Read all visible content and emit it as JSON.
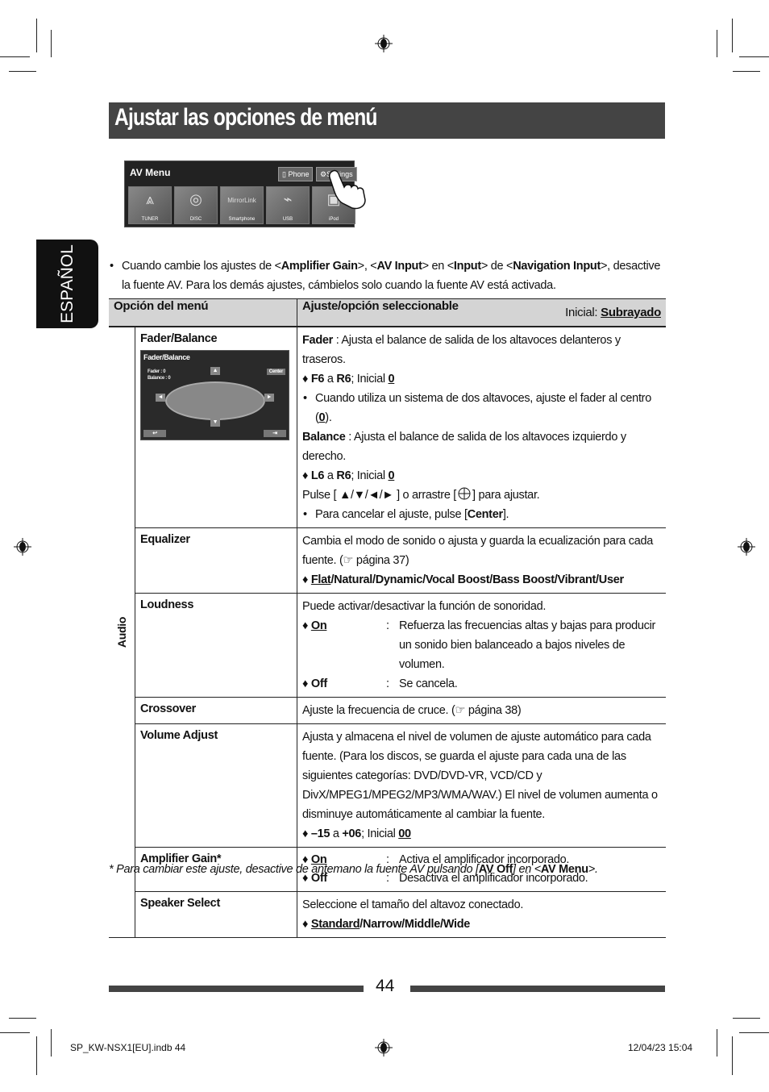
{
  "page": {
    "title": "Ajustar las opciones de menú",
    "language_tab": "ESPAÑOL",
    "page_number": "44",
    "slug_left": "SP_KW-NSX1[EU].indb   44",
    "slug_right": "12/04/23   15:04"
  },
  "av_menu_screen": {
    "title": "AV Menu",
    "buttons": [
      "Phone",
      "Settings"
    ],
    "tiles": [
      "TUNER",
      "DISC",
      "Smartphone",
      "USB",
      "iPod"
    ],
    "tile_overlay": "MirrorLink"
  },
  "note": {
    "text_a": "Cuando cambie los ajustes de <",
    "bold_a": "Amplifier Gain",
    "text_b": ">, <",
    "bold_b": "AV Input",
    "text_c": "> en <",
    "bold_c": "Input",
    "text_d": "> de <",
    "bold_d": "Navigation Input",
    "text_e": ">, desactive la fuente AV. Para los demás ajustes, cámbielos solo cuando la fuente AV está activada."
  },
  "table": {
    "header": {
      "col1": "Opción del menú",
      "col2": "Ajuste/opción seleccionable",
      "initial_label": "Inicial: ",
      "initial_value": "Subrayado"
    },
    "group_label": "Audio",
    "rows": [
      {
        "option": "Fader/Balance",
        "screen": {
          "title": "Fader/Balance",
          "fader": "Fader      : 0",
          "balance": "Balance   : 0",
          "center": "Center"
        },
        "fader_label": "Fader",
        "fader_desc": " : Ajusta el balance de salida de los altavoces delanteros y traseros.",
        "fader_range_a": "F6",
        "fader_range_mid": " a ",
        "fader_range_b": "R6",
        "fader_initial_text": "; Inicial ",
        "fader_initial": "0",
        "fader_bullet_a": "Cuando utiliza un sistema de dos altavoces, ajuste el fader al centro (",
        "fader_bullet_b": "0",
        "fader_bullet_c": ").",
        "balance_label": "Balance",
        "balance_desc": " : Ajusta el balance de salida de los altavoces izquierdo y derecho.",
        "balance_range_a": "L6",
        "balance_range_mid": " a ",
        "balance_range_b": "R6",
        "balance_initial_text": "; Inicial ",
        "balance_initial": "0",
        "press_text": "Pulse [ ▲/▼/◄/► ] o arrastre [",
        "press_text_b": "] para ajustar.",
        "cancel_a": "Para cancelar el ajuste, pulse [",
        "cancel_b": "Center",
        "cancel_c": "]."
      },
      {
        "option": "Equalizer",
        "desc": "Cambia el modo de sonido o ajusta y guarda la ecualización para cada fuente. (☞ página 37)",
        "choice_default": "Flat",
        "choice_rest": "/Natural/Dynamic/Vocal Boost/Bass Boost/Vibrant/User"
      },
      {
        "option": "Loudness",
        "desc": "Puede activar/desactivar la función de sonoridad.",
        "on_label": "On",
        "on_desc": "Refuerza las frecuencias altas y bajas para producir un sonido bien balanceado a bajos niveles de volumen.",
        "off_label": "Off",
        "off_desc": "Se cancela."
      },
      {
        "option": "Crossover",
        "desc": "Ajuste la frecuencia de cruce. (☞ página 38)"
      },
      {
        "option": "Volume Adjust",
        "desc": "Ajusta y almacena el nivel de volumen de ajuste automático para cada fuente. (Para los discos, se guarda el ajuste para cada una de las siguientes categorías: DVD/DVD-VR, VCD/CD y DivX/MPEG1/MPEG2/MP3/WMA/WAV.) El nivel de volumen aumenta o disminuye automáticamente al cambiar la fuente.",
        "range_a": "–15",
        "range_mid": " a ",
        "range_b": "+06",
        "initial_text": "; Inicial ",
        "initial": "00"
      },
      {
        "option": "Amplifier Gain*",
        "on_label": "On",
        "on_desc": "Activa el amplificador incorporado.",
        "off_label": "Off",
        "off_desc": "Desactiva el amplificador incorporado."
      },
      {
        "option": "Speaker Select",
        "desc": "Seleccione el tamaño del altavoz conectado.",
        "choice_default": "Standard",
        "choice_rest": "/Narrow/Middle/Wide"
      }
    ]
  },
  "footnote": {
    "a": "*  Para cambiar este ajuste, desactive de antemano la fuente AV pulsando [",
    "b": "AV Off",
    "c": "] en  <",
    "d": "AV Menu",
    "e": ">."
  },
  "symbols": {
    "diamond": "♦",
    "colon": ":"
  }
}
